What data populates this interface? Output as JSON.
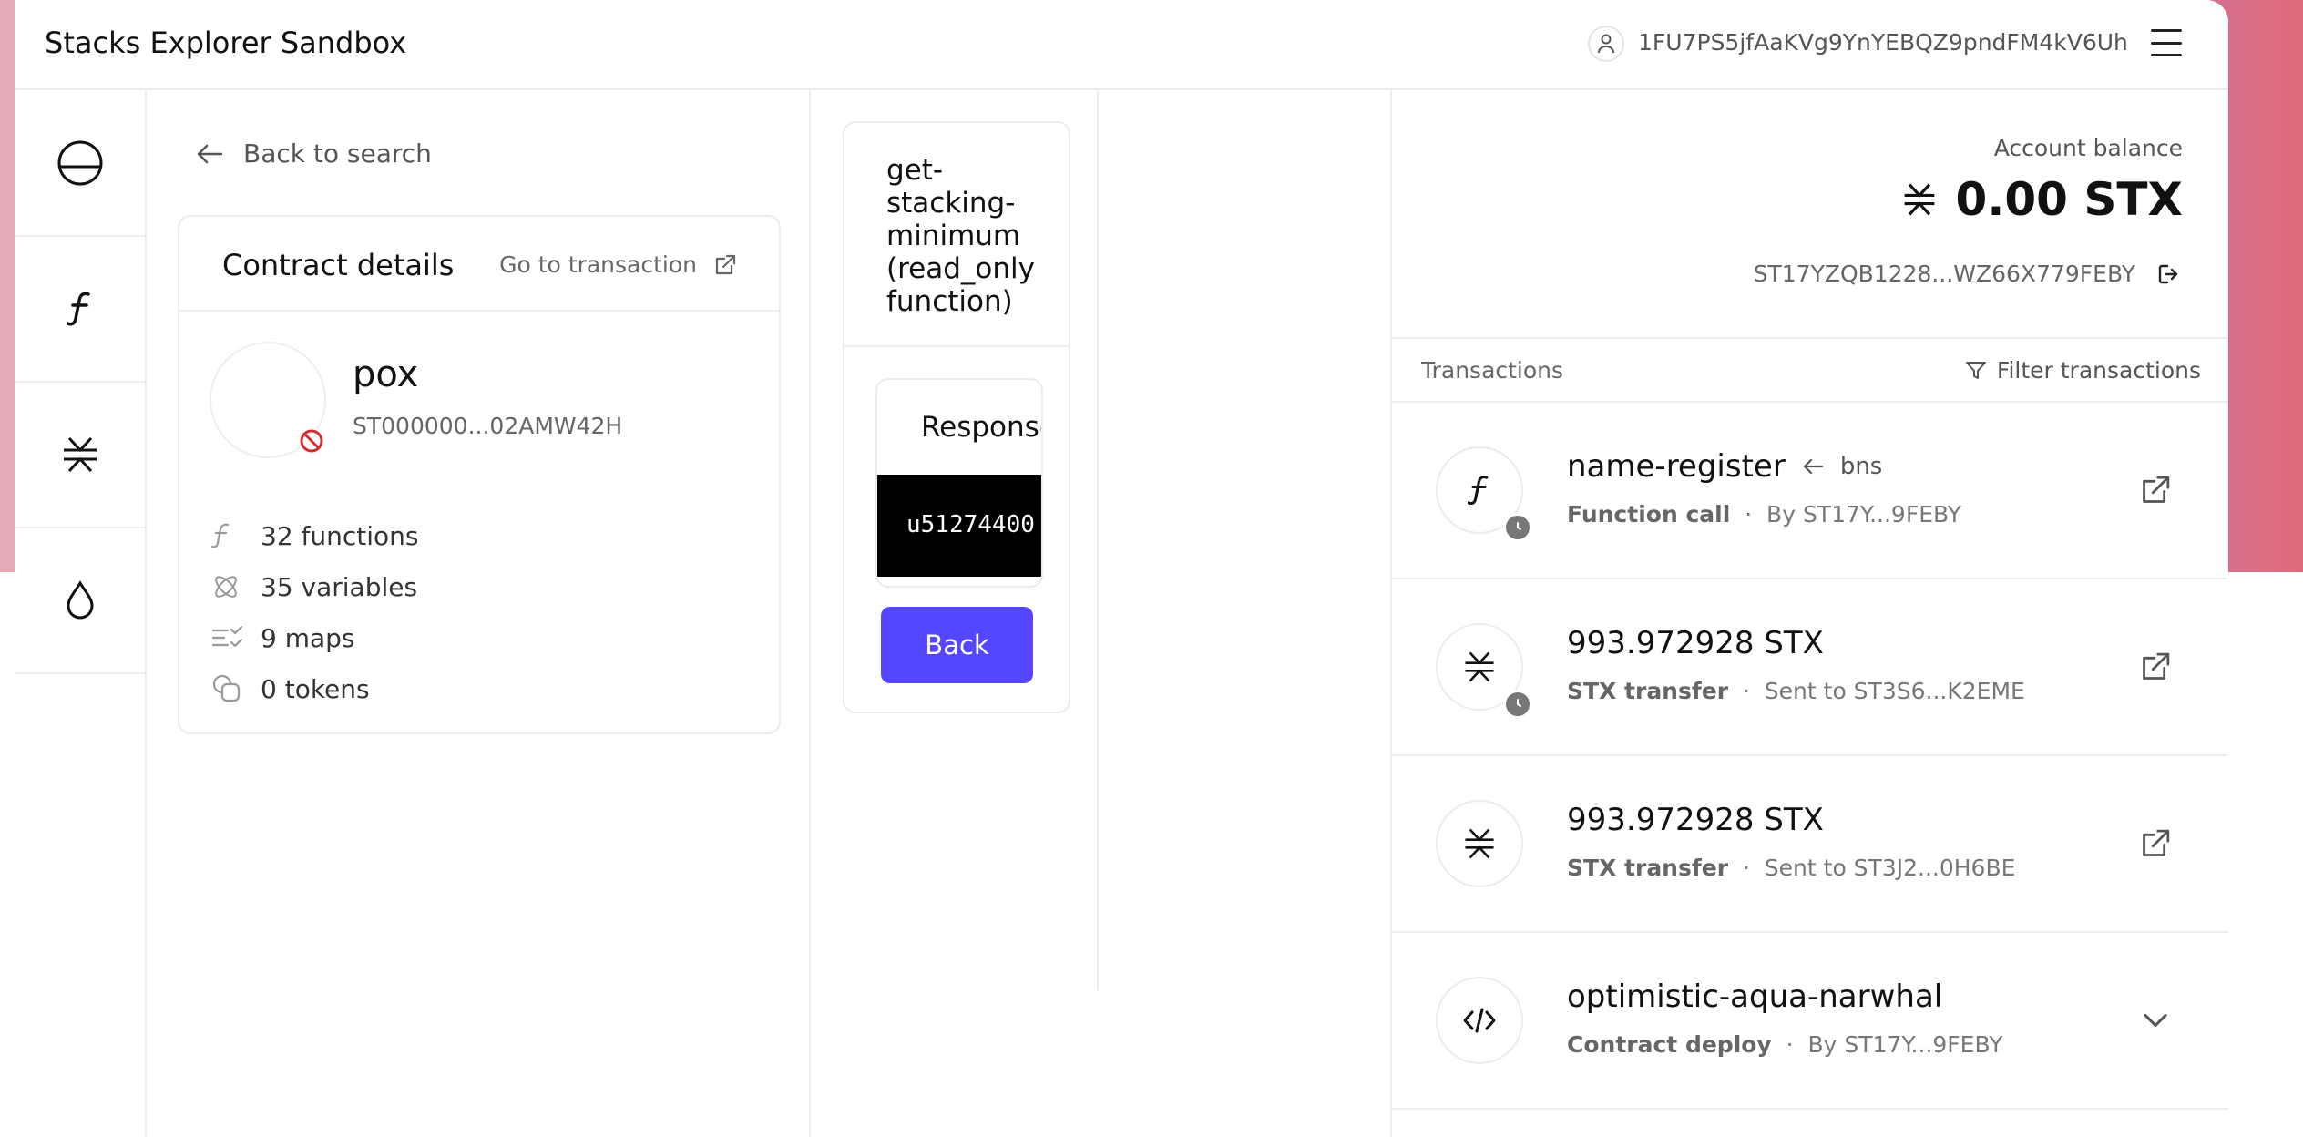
{
  "header": {
    "app_title": "Stacks Explorer Sandbox",
    "user_address": "1FU7PS5jfAaKVg9YnYEBQZ9pndFM4kV6Uh"
  },
  "rail": [
    "explorer-icon",
    "function-icon",
    "stx-icon",
    "faucet-icon"
  ],
  "contract": {
    "back_label": "Back to search",
    "card_title": "Contract details",
    "goto_label": "Go to transaction",
    "name": "pox",
    "address": "ST000000...02AMW42H",
    "stats": {
      "functions": "32 functions",
      "variables": "35 variables",
      "maps": "9 maps",
      "tokens": "0 tokens"
    }
  },
  "function_panel": {
    "title": "get-stacking-minimum (read_only function)",
    "response_title": "Response",
    "response_value": "u51274400",
    "back_label": "Back"
  },
  "account": {
    "balance_label": "Account balance",
    "balance": "0.00 STX",
    "address": "ST17YZQB1228...WZ66X779FEBY"
  },
  "transactions": {
    "label": "Transactions",
    "filter_label": "Filter transactions",
    "items": [
      {
        "title": "name-register",
        "sub": "bns",
        "type": "Function call",
        "detail": "By ST17Y...9FEBY",
        "icon": "function-icon",
        "pending": true
      },
      {
        "title": "993.972928 STX",
        "sub": "",
        "type": "STX transfer",
        "detail": "Sent to ST3S6...K2EME",
        "icon": "stx-icon",
        "pending": true
      },
      {
        "title": "993.972928 STX",
        "sub": "",
        "type": "STX transfer",
        "detail": "Sent to ST3J2...0H6BE",
        "icon": "stx-icon",
        "pending": false
      },
      {
        "title": "optimistic-aqua-narwhal",
        "sub": "",
        "type": "Contract deploy",
        "detail": "By ST17Y...9FEBY",
        "icon": "code-icon",
        "pending": false
      }
    ]
  },
  "sep": "·"
}
